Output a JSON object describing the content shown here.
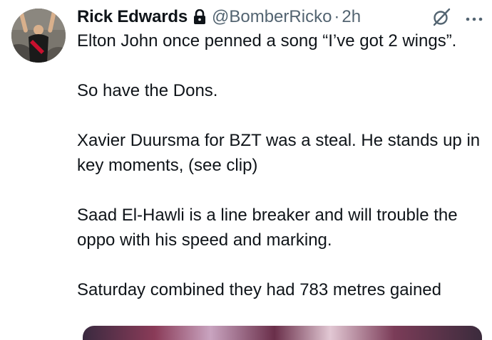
{
  "tweet": {
    "author": {
      "display_name": "Rick Edwards",
      "handle": "@BomberRicko",
      "separator": "·",
      "time": "2h",
      "locked": true
    },
    "icons": {
      "lock": "lock-icon",
      "grok": "grok-icon",
      "more": "more-icon"
    },
    "paragraphs": [
      "Elton John once penned a song “I’ve got 2 wings”.",
      "So have the Dons.",
      "Xavier Duursma for BZT was a steal. He stands up in key moments, (see clip)",
      "Saad El-Hawli is a line breaker and will trouble the oppo with his speed and marking.",
      "Saturday combined they had 783 metres gained"
    ]
  },
  "colors": {
    "text_primary": "#0f1419",
    "text_secondary": "#536471",
    "background": "#ffffff"
  }
}
